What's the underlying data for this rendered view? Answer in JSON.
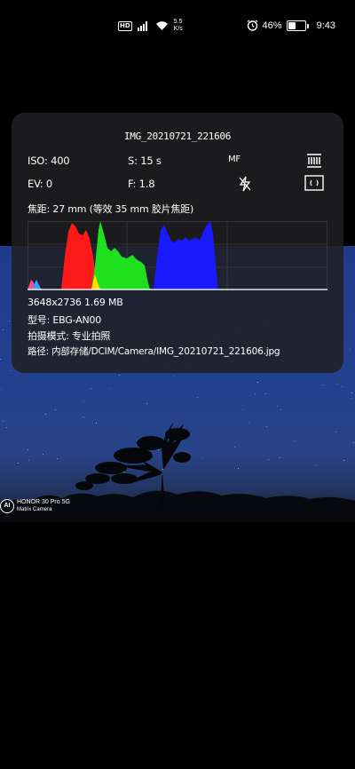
{
  "status_bar": {
    "hd_badge": "HD",
    "signal_label": "⁴ᴳ",
    "speed_value": "5.5",
    "speed_unit": "K/s",
    "battery_percent": "46%",
    "time": "9:43",
    "battery_level": 0.46
  },
  "info_card": {
    "file_name": "IMG_20210721_221606",
    "iso": "ISO: 400",
    "shutter": "S: 15 s",
    "focus_mode": "MF",
    "ev": "EV: 0",
    "aperture": "F: 1.8",
    "focal_length": "焦距: 27 mm (等效 35 mm 胶片焦距)",
    "resolution_size": "3648x2736  1.69 MB",
    "model": "型号:  EBG-AN00",
    "shooting_mode": "拍摄模式:  专业拍照",
    "path": "路径:  内部存储/DCIM/Camera/IMG_20210721_221606.jpg",
    "icons": {
      "flash": "flash-off-icon",
      "white_balance": "white-balance-icon",
      "metering": "metering-icon"
    },
    "histogram_colors": {
      "red": "#ff1a1a",
      "green": "#1ee01e",
      "blue": "#1a1aff",
      "yellow": "#ffe000",
      "white": "#ffffff"
    }
  },
  "watermark": {
    "logo": "AI",
    "line1": "HONOR 30 Pro 5G",
    "line2": "Matrix Camera"
  }
}
